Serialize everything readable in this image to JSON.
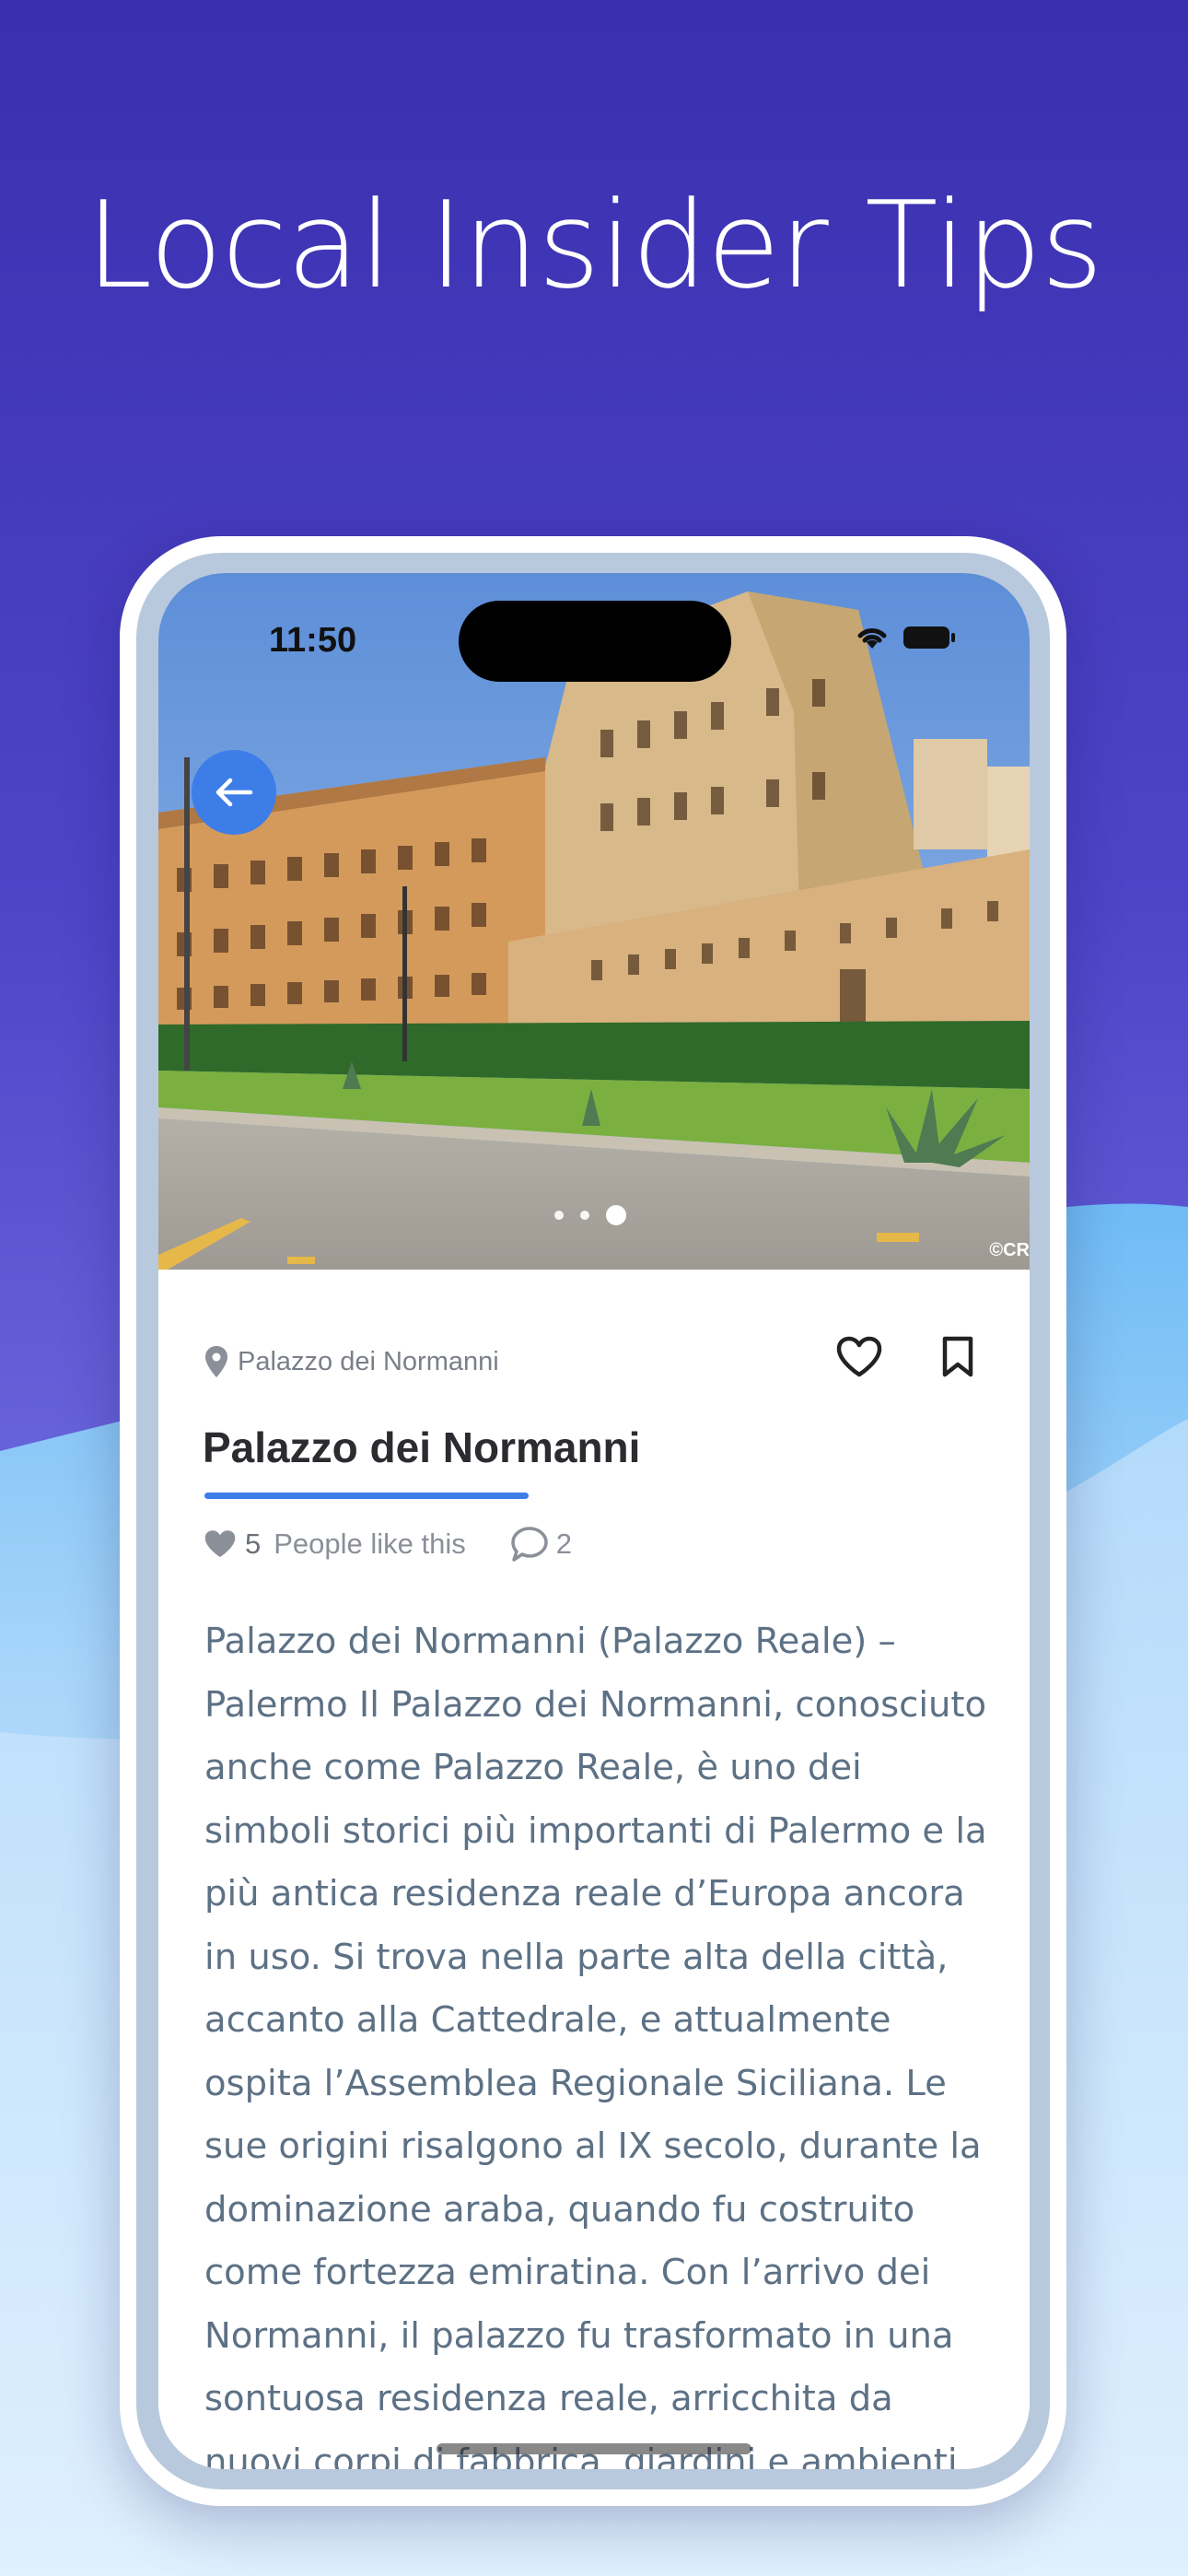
{
  "promo": {
    "headline": "Local Insider Tips"
  },
  "status_bar": {
    "time": "11:50"
  },
  "gallery": {
    "image_alt": "Palazzo dei Normanni",
    "page_count": 3,
    "active_page": 3,
    "credit": "©CR"
  },
  "place": {
    "location_label": "Palazzo dei Normanni",
    "title": "Palazzo dei Normanni",
    "likes_count": "5",
    "likes_label": "People like this",
    "comments_count": "2",
    "description": "Palazzo dei Normanni (Palazzo Reale) – Palermo Il Palazzo dei Normanni, conosciuto anche come Palazzo Reale, è uno dei simboli storici più importanti di Palermo e la più antica residenza reale d’Europa ancora in uso. Si trova nella parte alta della città, accanto alla Cattedrale, e attualmente ospita l’Assemblea Regionale Siciliana. Le sue origini risalgono al IX secolo, durante la dominazione araba, quando fu costruito come fortezza emiratina. Con l’arrivo dei Normanni, il palazzo fu trasformato in una sontuosa residenza reale, arricchita da nuovi corpi di fabbrica, giardini e ambienti decorati"
  },
  "icons": {
    "back": "arrow-left-icon",
    "location": "map-pin-icon",
    "like": "heart-outline-icon",
    "bookmark": "bookmark-icon",
    "likes_stat": "heart-filled-icon",
    "comments_stat": "comment-bubble-icon",
    "wifi": "wifi-icon",
    "battery": "battery-icon"
  },
  "colors": {
    "accent": "#3d7de8",
    "headline_bg": "#3a2fae",
    "body_text": "#5d7185",
    "title_text": "#2b2b30"
  }
}
